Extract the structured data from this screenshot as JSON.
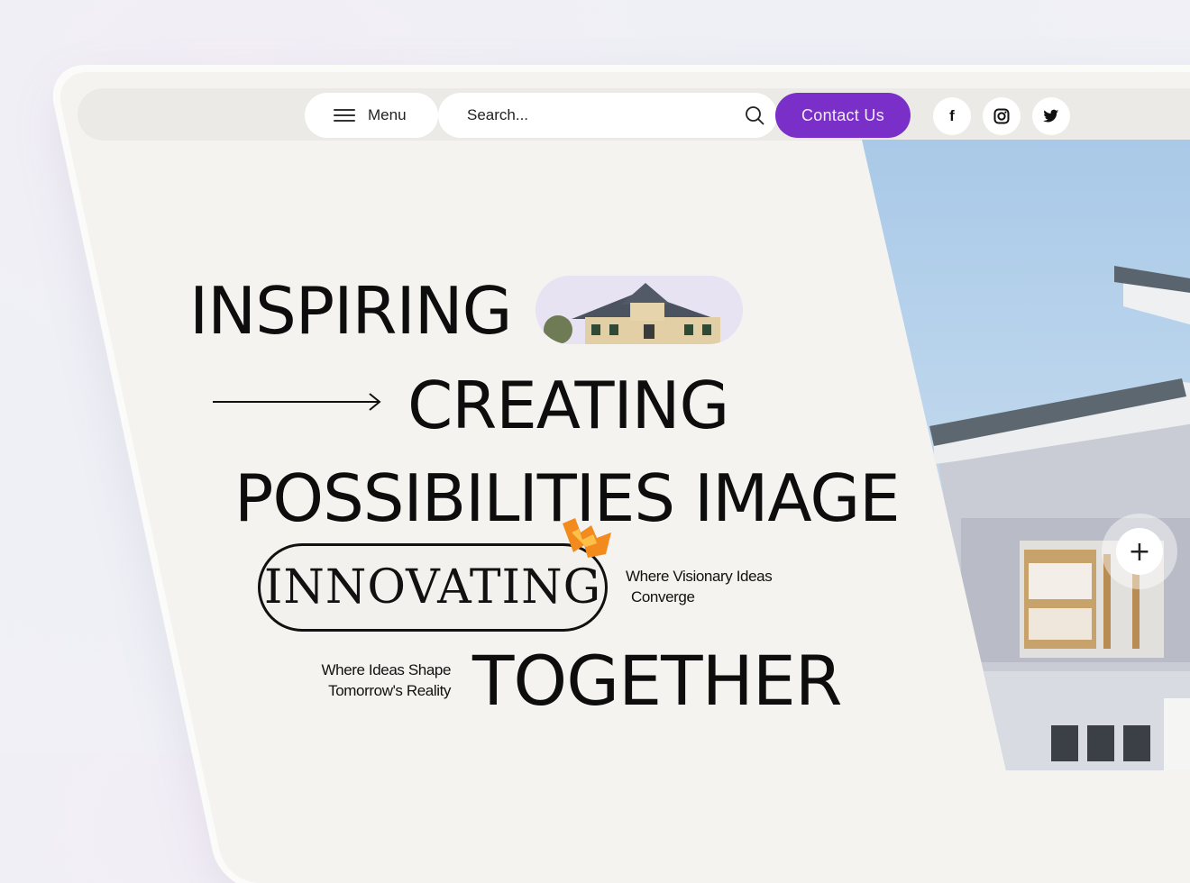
{
  "nav": {
    "menu_label": "Menu",
    "search_placeholder": "Search...",
    "contact_label": "Contact Us",
    "social": [
      {
        "icon": "facebook-icon",
        "glyph": "f"
      },
      {
        "icon": "instagram-icon",
        "glyph": "◎"
      },
      {
        "icon": "twitter-icon",
        "glyph": "🐦"
      }
    ]
  },
  "hero": {
    "line1": "INSPIRING",
    "line2": "CREATING",
    "line3": "POSSIBILITIES IMAGE",
    "line4": "INNOVATING",
    "line5": "TOGETHER",
    "tagline1": [
      "Where Visionary Ideas",
      "Converge"
    ],
    "tagline2": [
      "Where Ideas Shape",
      "Tomorrow's Reality"
    ]
  },
  "colors": {
    "accent": "#7b2fc9",
    "spark": "#f28a1e",
    "background": "#f4f3ef"
  }
}
